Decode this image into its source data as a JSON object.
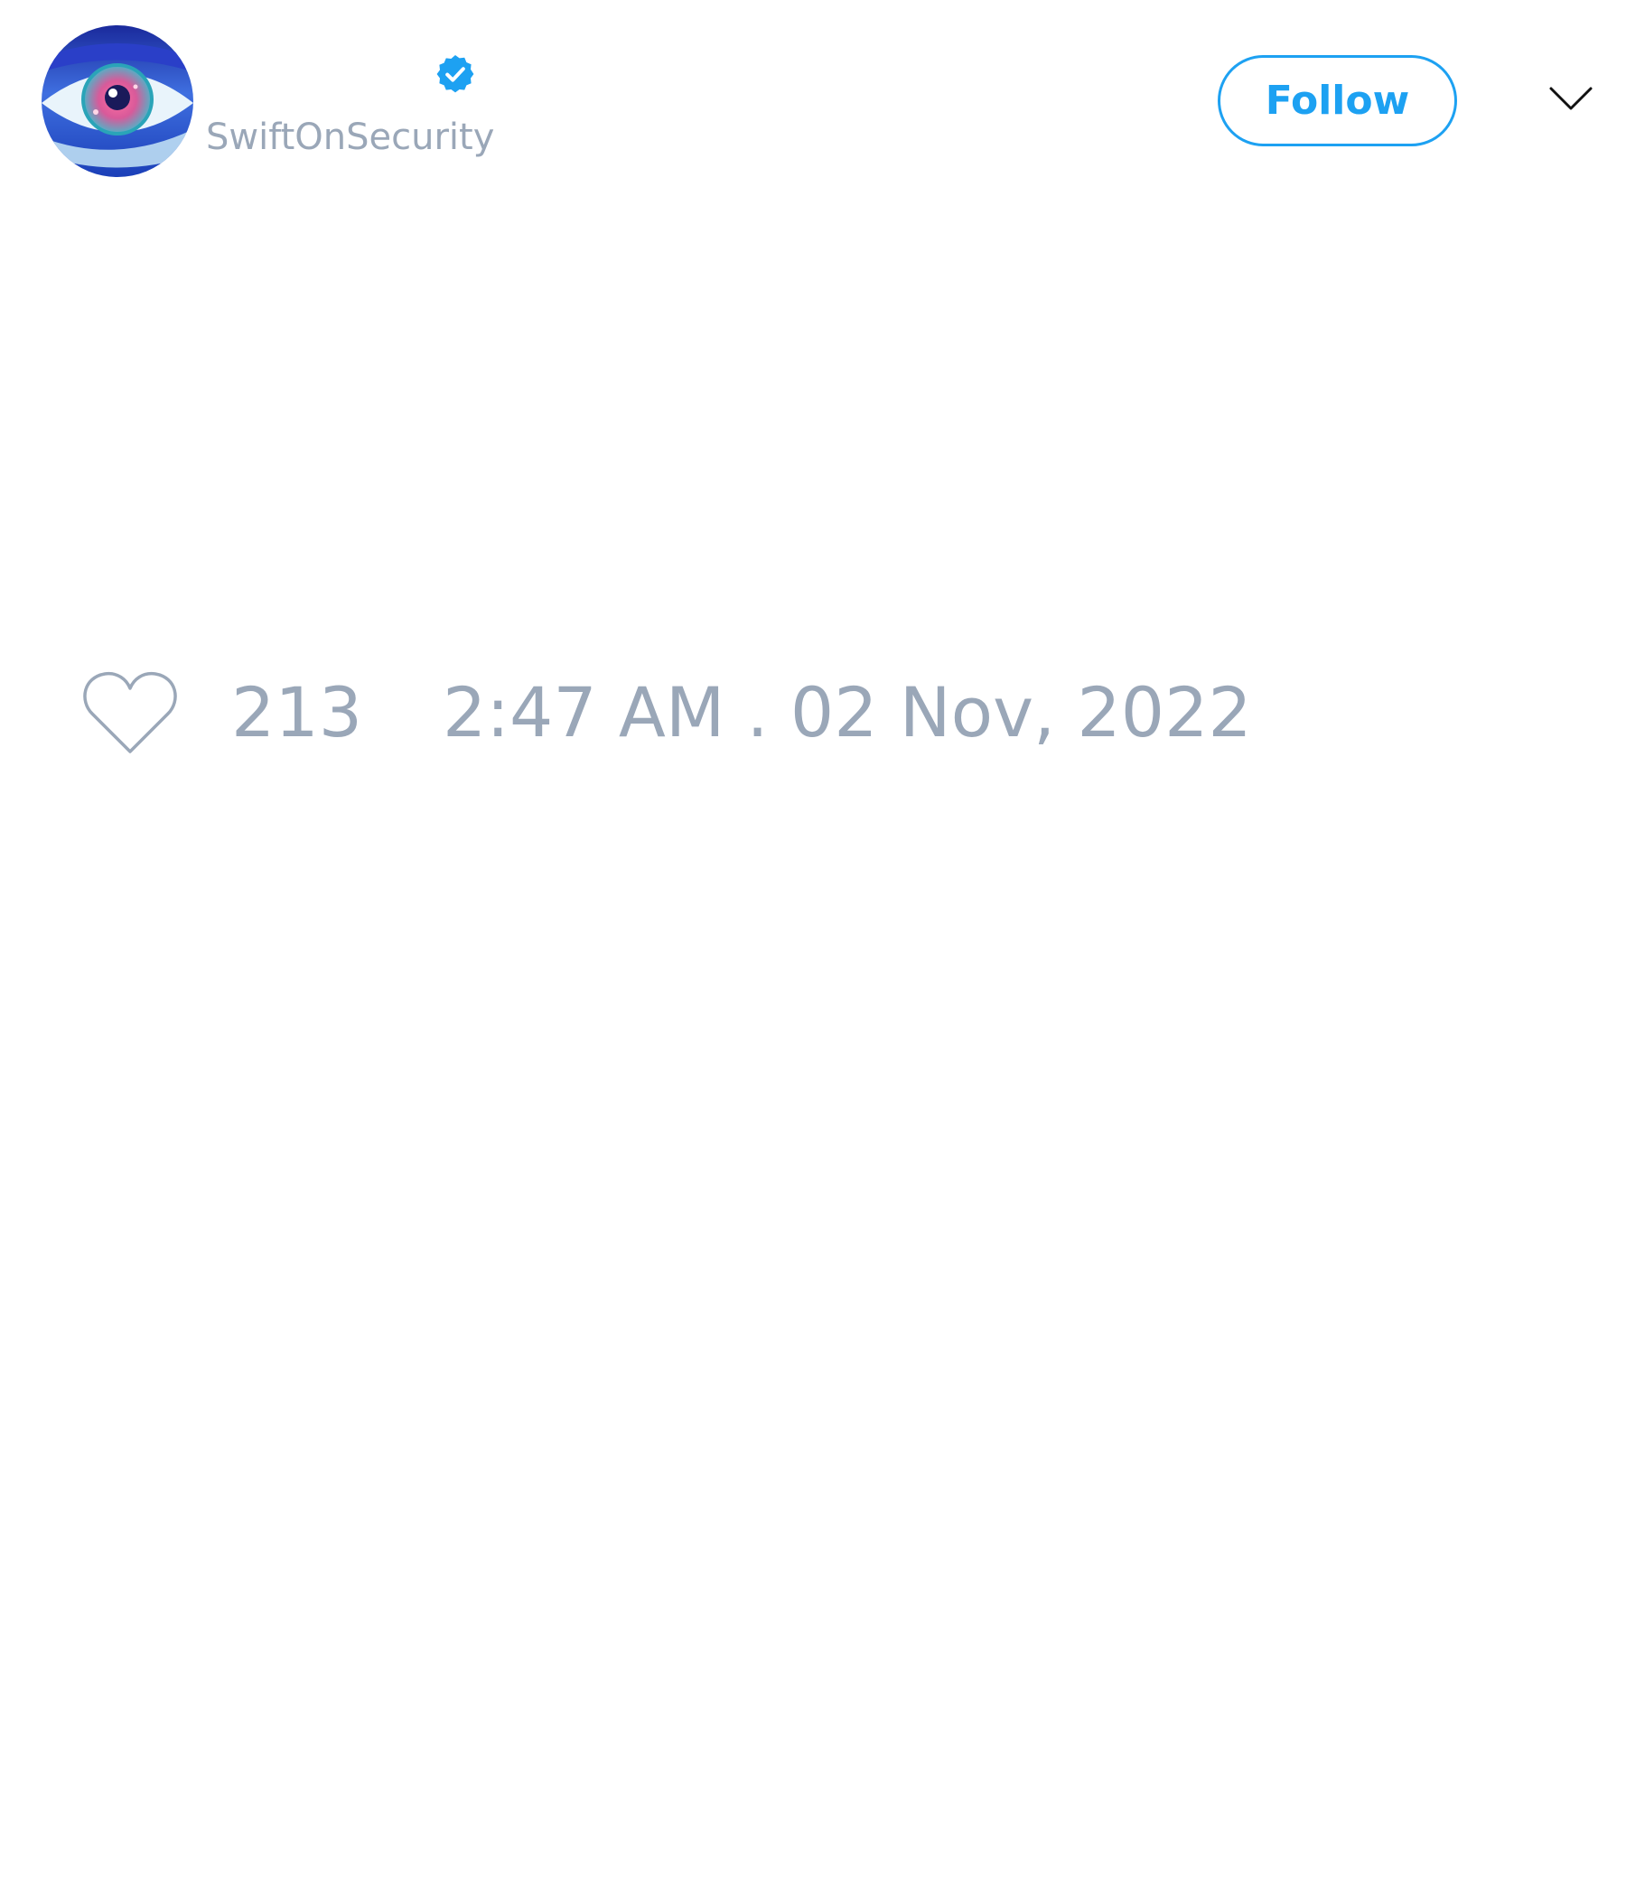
{
  "author": {
    "display_name": "",
    "handle": "SwiftOnSecurity",
    "verified": true,
    "avatar_icon": "eye-avatar-icon"
  },
  "actions": {
    "follow_label": "Follow",
    "menu_icon": "chevron-down-icon"
  },
  "tweet": {
    "like_icon": "heart-outline-icon",
    "like_count": "213",
    "timestamp": "2:47 AM . 02 Nov, 2022"
  },
  "colors": {
    "accent": "#1da1f2",
    "muted_text": "#9aa7b8",
    "icon_stroke": "#9aa7b8",
    "chevron": "#111111",
    "background": "#ffffff"
  }
}
